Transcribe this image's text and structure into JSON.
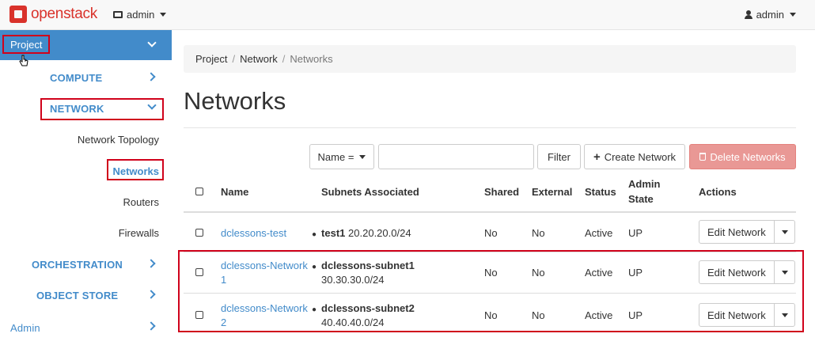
{
  "topbar": {
    "brand": "openstack",
    "project_menu": "admin",
    "user_menu": "admin"
  },
  "sidebar": {
    "project": "Project",
    "sections": {
      "compute": "COMPUTE",
      "network": "NETWORK",
      "orchestration": "ORCHESTRATION",
      "object_store": "OBJECT STORE",
      "admin": "Admin"
    },
    "network_items": [
      "Network Topology",
      "Networks",
      "Routers",
      "Firewalls"
    ]
  },
  "breadcrumb": [
    "Project",
    "Network",
    "Networks"
  ],
  "page_title": "Networks",
  "toolbar": {
    "filter_field": "Name =",
    "filter_value": "",
    "filter_button": "Filter",
    "create_button": "Create Network",
    "delete_button": "Delete Networks"
  },
  "table": {
    "headers": {
      "name": "Name",
      "subnets": "Subnets Associated",
      "shared": "Shared",
      "external": "External",
      "status": "Status",
      "admin_state_1": "Admin",
      "admin_state_2": "State",
      "actions": "Actions"
    },
    "rows": [
      {
        "name_line1": "dclessons-test",
        "name_line2": "",
        "subnet_name": "test1",
        "subnet_cidr": "20.20.20.0/24",
        "shared": "No",
        "external": "No",
        "status": "Active",
        "admin_state": "UP",
        "action": "Edit Network"
      },
      {
        "name_line1": "dclessons-Network",
        "name_line2": "1",
        "subnet_name": "dclessons-subnet1",
        "subnet_cidr": "30.30.30.0/24",
        "shared": "No",
        "external": "No",
        "status": "Active",
        "admin_state": "UP",
        "action": "Edit Network"
      },
      {
        "name_line1": "dclessons-Network",
        "name_line2": "2",
        "subnet_name": "dclessons-subnet2",
        "subnet_cidr": "40.40.40.0/24",
        "shared": "No",
        "external": "No",
        "status": "Active",
        "admin_state": "UP",
        "action": "Edit Network"
      }
    ]
  },
  "colors": {
    "brand_red": "#d9322b",
    "accent_blue": "#428bca",
    "highlight_red": "#d0021b",
    "danger_button": "#e99895"
  }
}
